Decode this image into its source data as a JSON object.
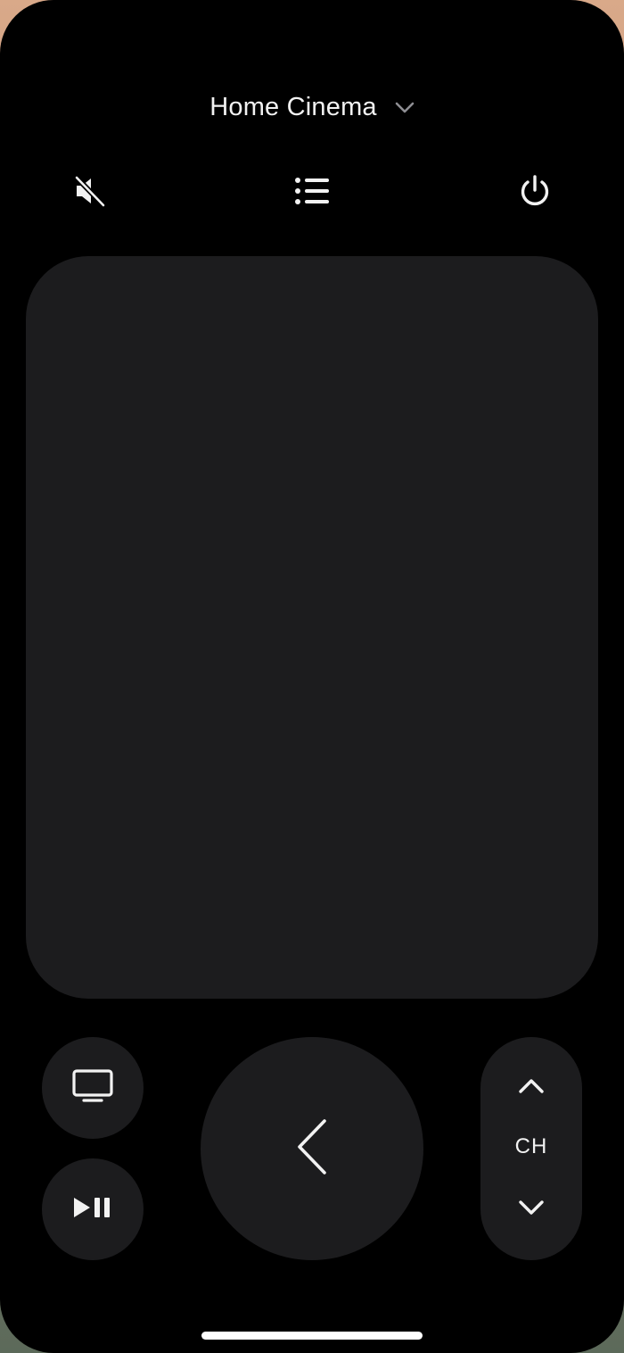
{
  "header": {
    "device_name": "Home Cinema"
  },
  "toolbar": {
    "mute_icon": "speaker-mute-icon",
    "guide_icon": "list-icon",
    "power_icon": "power-icon"
  },
  "controls": {
    "tv_icon": "tv-icon",
    "play_pause_icon": "play-pause-icon",
    "back_icon": "chevron-left-icon",
    "channel_label": "CH",
    "channel_up_icon": "chevron-up-icon",
    "channel_down_icon": "chevron-down-icon"
  },
  "colors": {
    "background": "#000000",
    "surface": "#1c1c1e",
    "foreground": "#f2f2f2",
    "secondary": "#8e8e93"
  }
}
